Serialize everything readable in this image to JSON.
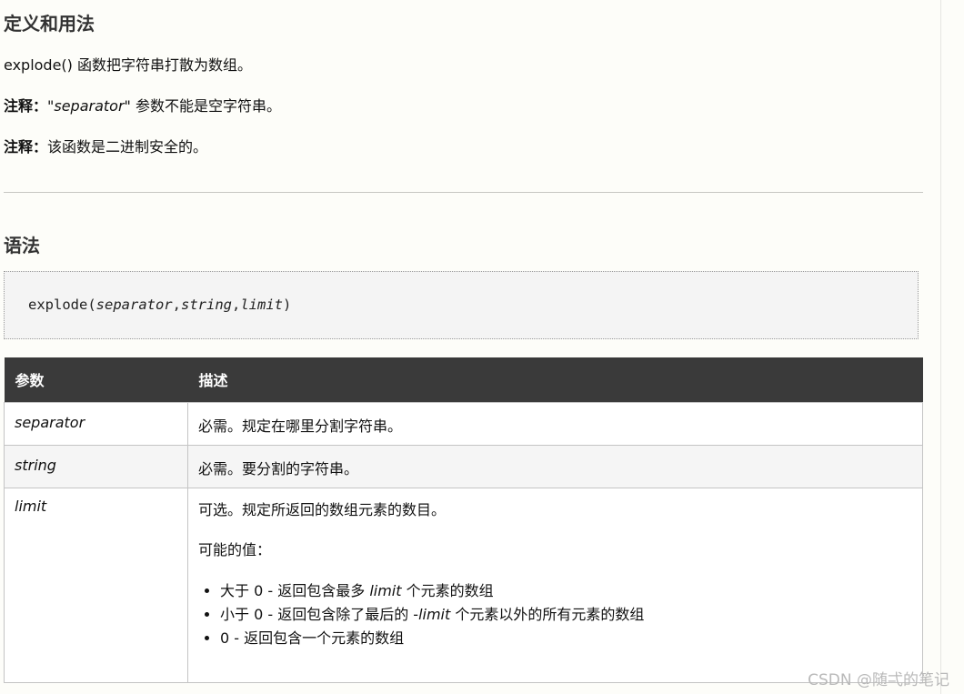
{
  "section_definition": {
    "heading": "定义和用法",
    "p1_code": "explode()",
    "p1_rest": " 函数把字符串打散为数组。",
    "note1_label": "注释：",
    "note1_open": "\"",
    "note1_param": "separator",
    "note1_close": "\"",
    "note1_text": " 参数不能是空字符串。",
    "note2_label": "注释：",
    "note2_text": "该函数是二进制安全的。"
  },
  "section_syntax": {
    "heading": "语法",
    "code_fn": "explode(",
    "code_arg1": "separator",
    "code_comma1": ",",
    "code_arg2": "string",
    "code_comma2": ",",
    "code_arg3": "limit",
    "code_close": ")"
  },
  "params_table": {
    "headers": [
      "参数",
      "描述"
    ],
    "rows": [
      {
        "name": "separator",
        "desc": "必需。规定在哪里分割字符串。"
      },
      {
        "name": "string",
        "desc": "必需。要分割的字符串。"
      },
      {
        "name": "limit",
        "desc": "可选。规定所返回的数组元素的数目。",
        "possible_label": "可能的值：",
        "values": [
          {
            "pre": "大于 0 - 返回包含最多 ",
            "em": "limit",
            "post": " 个元素的数组"
          },
          {
            "pre": "小于 0 - 返回包含除了最后的 -",
            "em": "limit",
            "post": " 个元素以外的所有元素的数组"
          },
          {
            "pre": "0 - 返回包含一个元素的数组",
            "em": "",
            "post": ""
          }
        ]
      }
    ]
  },
  "watermark": "CSDN @随弌的笔记"
}
